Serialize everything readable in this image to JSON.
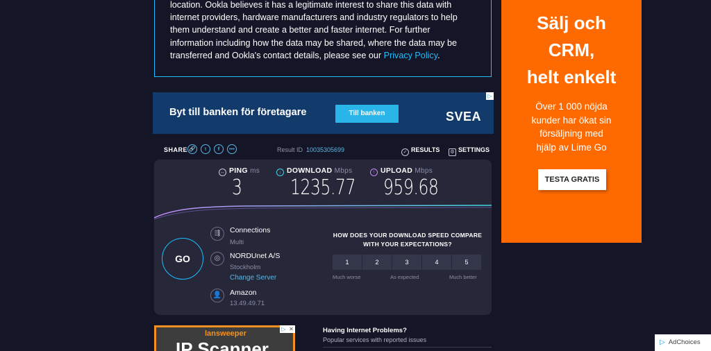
{
  "privacy": {
    "lines": [
      "location. Ookla believes it has a legitimate interest to share this data with",
      "internet providers, hardware manufacturers and industry regulators to help",
      "them understand and create a better and faster internet. For further",
      "information including how the data may be shared, where the data may be"
    ],
    "last_line_prefix": "transferred and Ookla's contact details, please see our ",
    "policy_link": "Privacy Policy",
    "last_line_suffix": "."
  },
  "ad_banner": {
    "headline": "Byt till banken för företagare",
    "button": "Till banken",
    "brand": "SVEA"
  },
  "share_bar": {
    "share_label": "SHARE",
    "result_label": "Result ID",
    "result_id": "10035305699",
    "results_label": "RESULTS",
    "settings_label": "SETTINGS"
  },
  "metrics": {
    "ping": {
      "label": "PING",
      "unit": "ms",
      "value": "3"
    },
    "download": {
      "label": "DOWNLOAD",
      "unit": "Mbps",
      "value": "1235.77"
    },
    "upload": {
      "label": "UPLOAD",
      "unit": "Mbps",
      "value": "959.68"
    }
  },
  "go_label": "GO",
  "connections": {
    "title": "Connections",
    "value": "Multi"
  },
  "isp": {
    "title": "NORDUnet A/S",
    "location": "Stockholm",
    "change_link": "Change Server"
  },
  "host": {
    "title": "Amazon",
    "ip": "13.49.49.71"
  },
  "expectations": {
    "question_line1": "HOW DOES YOUR DOWNLOAD SPEED COMPARE",
    "question_line2": "WITH YOUR EXPECTATIONS?",
    "ratings": [
      "1",
      "2",
      "3",
      "4",
      "5"
    ],
    "scale_low": "Much worse",
    "scale_mid": "As expected",
    "scale_high": "Much better"
  },
  "bottom_ad": {
    "brand": "lansweeper",
    "headline": "IP Scanner"
  },
  "problems": {
    "title": "Having Internet Problems?",
    "subtitle": "Popular services with reported issues"
  },
  "side_ad": {
    "headline_lines": [
      "Sälj och",
      "CRM,",
      "helt enkelt"
    ],
    "body_lines": [
      "Över 1 000 nöjda",
      "kunder har ökat sin",
      "försäljning med",
      "hjälp av Lime Go"
    ],
    "cta": "TESTA GRATIS"
  },
  "adchoices_label": "AdChoices",
  "colors": {
    "accent": "#1cbfff",
    "panel": "#262739",
    "background": "#141526",
    "side_ad": "#ff6a00"
  }
}
